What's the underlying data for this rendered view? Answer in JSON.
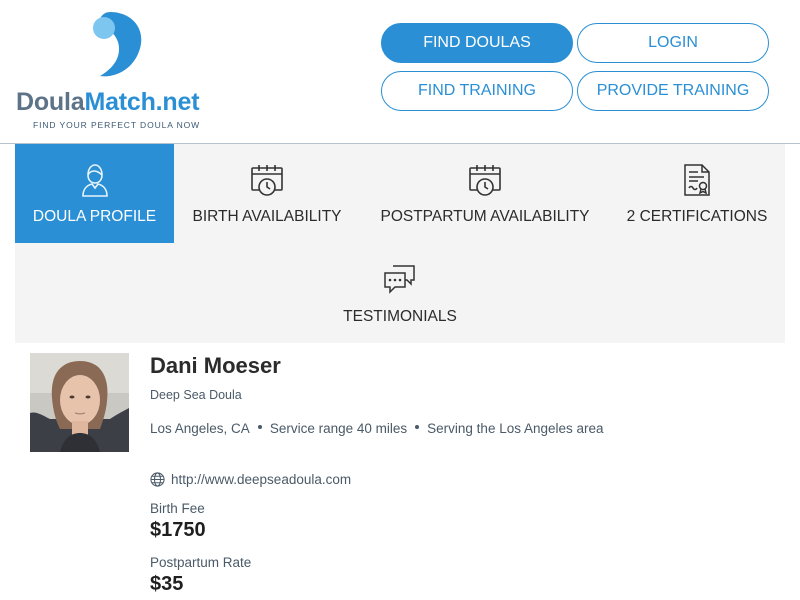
{
  "brand": {
    "name_part1": "Doula",
    "name_part2": "Match.net",
    "tagline": "FIND YOUR PERFECT DOULA NOW",
    "primary_color": "#2a8fd4",
    "text_color": "#5d7388"
  },
  "header": {
    "buttons": {
      "find_doulas": "FIND DOULAS",
      "login": "LOGIN",
      "find_training": "FIND TRAINING",
      "provide_training": "PROVIDE TRAINING"
    }
  },
  "tabs": [
    {
      "label": "DOULA PROFILE",
      "icon": "person-icon",
      "active": true
    },
    {
      "label": "BIRTH AVAILABILITY",
      "icon": "calendar-clock-icon",
      "active": false
    },
    {
      "label": "POSTPARTUM AVAILABILITY",
      "icon": "calendar-clock-icon",
      "active": false
    },
    {
      "label": "2 CERTIFICATIONS",
      "icon": "certificate-icon",
      "active": false
    },
    {
      "label": "TESTIMONIALS",
      "icon": "chat-bubbles-icon",
      "active": false
    }
  ],
  "profile": {
    "name": "Dani Moeser",
    "business": "Deep Sea Doula",
    "location": "Los Angeles, CA",
    "service_range": "Service range 40 miles",
    "serving": "Serving the Los Angeles area",
    "website": "http://www.deepseadoula.com",
    "birth_fee_label": "Birth Fee",
    "birth_fee": "$1750",
    "postpartum_label": "Postpartum Rate",
    "postpartum_rate": "$35"
  }
}
